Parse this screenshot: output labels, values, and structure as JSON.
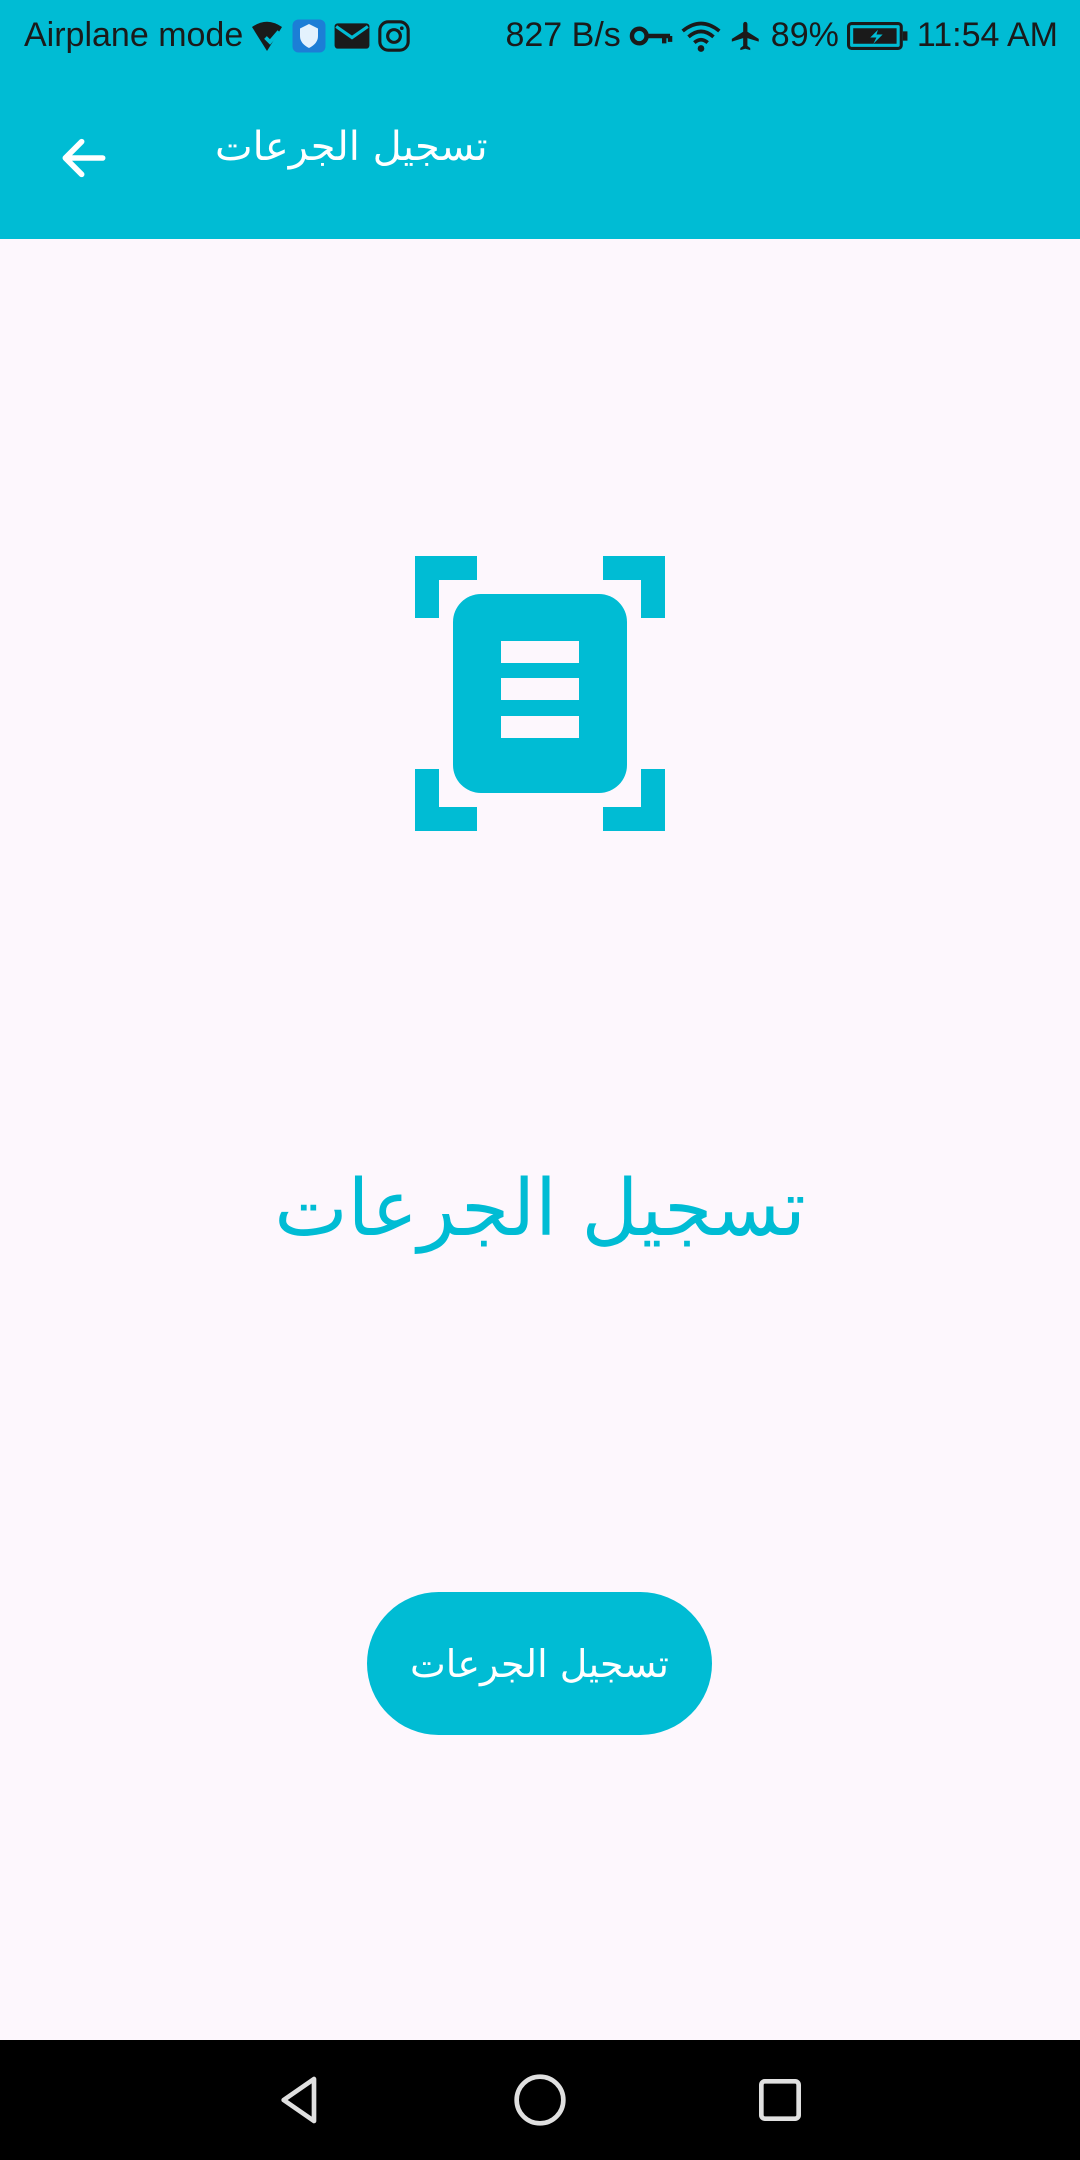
{
  "status_bar": {
    "airplane_mode_label": "Airplane mode",
    "network_speed": "827 B/s",
    "battery_percent": "89%",
    "time": "11:54 AM",
    "icons": [
      "no-wifi-check-icon",
      "vpn-shield-icon",
      "mail-icon",
      "instagram-icon",
      "key-icon",
      "wifi-icon",
      "airplane-icon",
      "battery-icon"
    ]
  },
  "app_bar": {
    "title": "تسجيل الجرعات",
    "back_icon": "arrow-left-icon"
  },
  "main": {
    "illustration_icon": "document-scan-icon",
    "heading": "تسجيل الجرعات",
    "action_button_label": "تسجيل الجرعات"
  },
  "nav_bar": {
    "icons": [
      "back-triangle-icon",
      "home-circle-icon",
      "recents-square-icon"
    ]
  },
  "colors": {
    "primary": "#00bcd4",
    "background": "#fdf7fd",
    "on_primary": "#ffffff"
  }
}
